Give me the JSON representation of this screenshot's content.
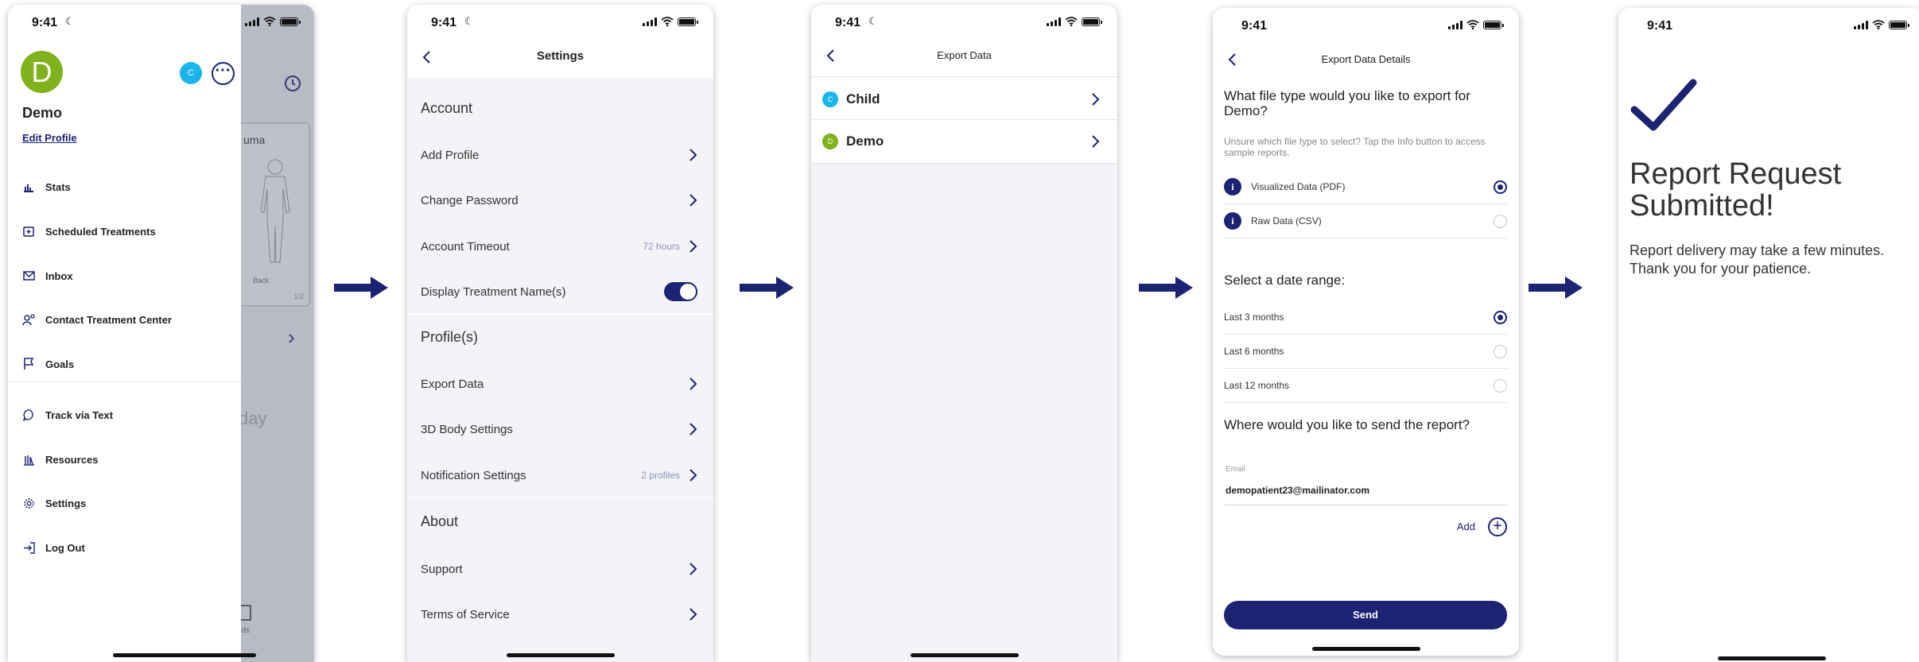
{
  "status_time": "9:41",
  "screen1": {
    "background": {
      "card_title": "uma",
      "card_subtitle": "Back",
      "card_page": "1/2",
      "day_text": "day",
      "tab_label": "rds"
    },
    "drawer": {
      "avatar_letter": "D",
      "avatar_color": "#7fb21c",
      "child_avatar_letter": "C",
      "child_avatar_color": "#1ab5ea",
      "user_name": "Demo",
      "edit_profile": "Edit Profile",
      "menu_items": [
        {
          "label": "Stats",
          "icon": "bar-chart-icon"
        },
        {
          "label": "Scheduled Treatments",
          "icon": "calendar-plus-icon"
        },
        {
          "label": "Inbox",
          "icon": "envelope-icon"
        },
        {
          "label": "Contact Treatment Center",
          "icon": "contact-icon"
        },
        {
          "label": "Goals",
          "icon": "flag-icon"
        },
        {
          "label": "Track via Text",
          "icon": "chat-bubble-icon"
        },
        {
          "label": "Resources",
          "icon": "books-icon"
        },
        {
          "label": "Settings",
          "icon": "gear-icon"
        },
        {
          "label": "Log Out",
          "icon": "logout-icon"
        }
      ]
    }
  },
  "screen2": {
    "title": "Settings",
    "sections": {
      "account": "Account",
      "profiles": "Profile(s)",
      "about": "About"
    },
    "rows": {
      "add_profile": "Add Profile",
      "change_password": "Change Password",
      "account_timeout": "Account Timeout",
      "account_timeout_value": "72 hours",
      "display_treatment": "Display Treatment Name(s)",
      "display_treatment_on": true,
      "export_data": "Export Data",
      "body_settings": "3D Body Settings",
      "notification_settings": "Notification Settings",
      "notification_value": "2 profiles",
      "support": "Support",
      "terms": "Terms of Service"
    }
  },
  "screen3": {
    "title": "Export Data",
    "profiles": [
      {
        "initial": "C",
        "name": "Child",
        "color": "#1ab5ea"
      },
      {
        "initial": "D",
        "name": "Demo",
        "color": "#7fb21c"
      }
    ]
  },
  "screen4": {
    "title": "Export Data Details",
    "file_question": "What file type would you like to export for Demo?",
    "file_hint": "Unsure which file type to select? Tap the Info button to access sample reports.",
    "file_types": [
      {
        "label": "Visualized Data (PDF)",
        "selected": true
      },
      {
        "label": "Raw Data (CSV)",
        "selected": false
      }
    ],
    "date_question": "Select a date range:",
    "date_ranges": [
      {
        "label": "Last 3 months",
        "selected": true
      },
      {
        "label": "Last 6 months",
        "selected": false
      },
      {
        "label": "Last 12 months",
        "selected": false
      }
    ],
    "send_question": "Where would you like to send the report?",
    "email_label": "Email",
    "email_value": "demopatient23@mailinator.com",
    "add_label": "Add",
    "send_button": "Send"
  },
  "screen5": {
    "title": "Report Request Submitted!",
    "message": "Report delivery may take a few minutes. Thank you for your patience."
  },
  "colors": {
    "brand_navy": "#1c2372",
    "muted_value": "#8e93b8"
  }
}
